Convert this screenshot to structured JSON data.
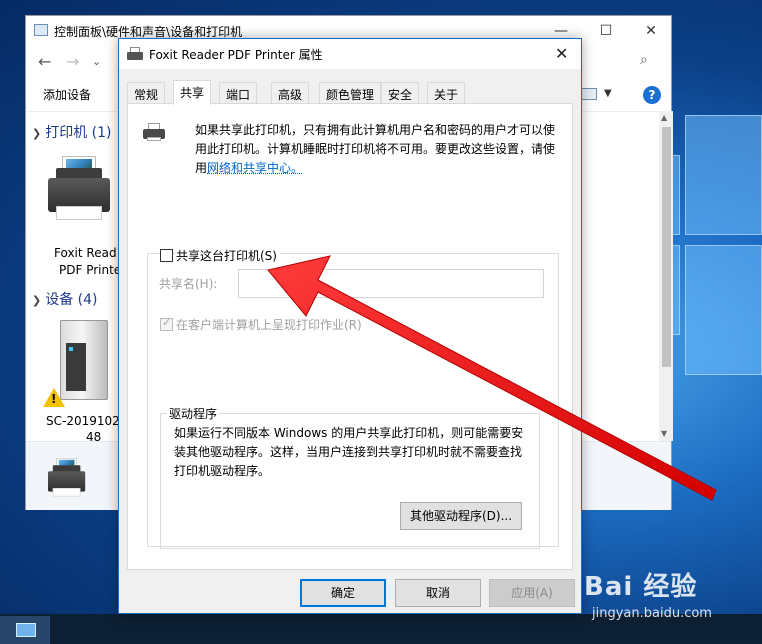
{
  "explorer": {
    "title": "控制面板\\硬件和声音\\设备和打印机",
    "add_device": "添加设备",
    "help": "?",
    "printers_group": "打印机 (1)",
    "devices_group": "设备 (4)",
    "printer_tile_line1": "Foxit Read",
    "printer_tile_line2": "PDF Printe",
    "device_tile_line1": "SC-2019102",
    "device_tile_line2": "48",
    "minimize": "—",
    "maximize": "☐",
    "close": "✕"
  },
  "dialog": {
    "title": "Foxit Reader PDF Printer 属性",
    "close": "✕",
    "tabs": [
      {
        "label": "常规"
      },
      {
        "label": "共享"
      },
      {
        "label": "端口"
      },
      {
        "label": "高级"
      },
      {
        "label": "颜色管理"
      },
      {
        "label": "安全"
      },
      {
        "label": "关于"
      }
    ],
    "active_tab": "共享",
    "info_line1": "如果共享此打印机，只有拥有此计算机用户名和密码的用户才可以使",
    "info_line2": "用此打印机。计算机睡眠时打印机将不可用。要更改这些设置，请使",
    "info_line3_prefix": "用",
    "info_link": "网络和共享中心。",
    "share_checkbox_label": "共享这台打印机(S)",
    "share_checked": false,
    "share_name_label": "共享名(H):",
    "share_name_value": "",
    "render_jobs_label": "在客户端计算机上呈现打印作业(R)",
    "render_jobs_checked": true,
    "drivers_legend": "驱动程序",
    "drivers_line1": "如果运行不同版本 Windows 的用户共享此打印机，则可能需要安",
    "drivers_line2": "装其他驱动程序。这样，当用户连接到共享打印机时就不需要查找",
    "drivers_line3": "打印机驱动程序。",
    "other_drivers_button": "其他驱动程序(D)...",
    "ok_button": "确定",
    "cancel_button": "取消",
    "apply_button": "应用(A)"
  },
  "watermark": {
    "brand": "Bai 经验",
    "url": "jingyan.baidu.com"
  },
  "colors": {
    "arrow": "#ff1a1a",
    "accent": "#0078d7",
    "link": "#0066cc"
  }
}
